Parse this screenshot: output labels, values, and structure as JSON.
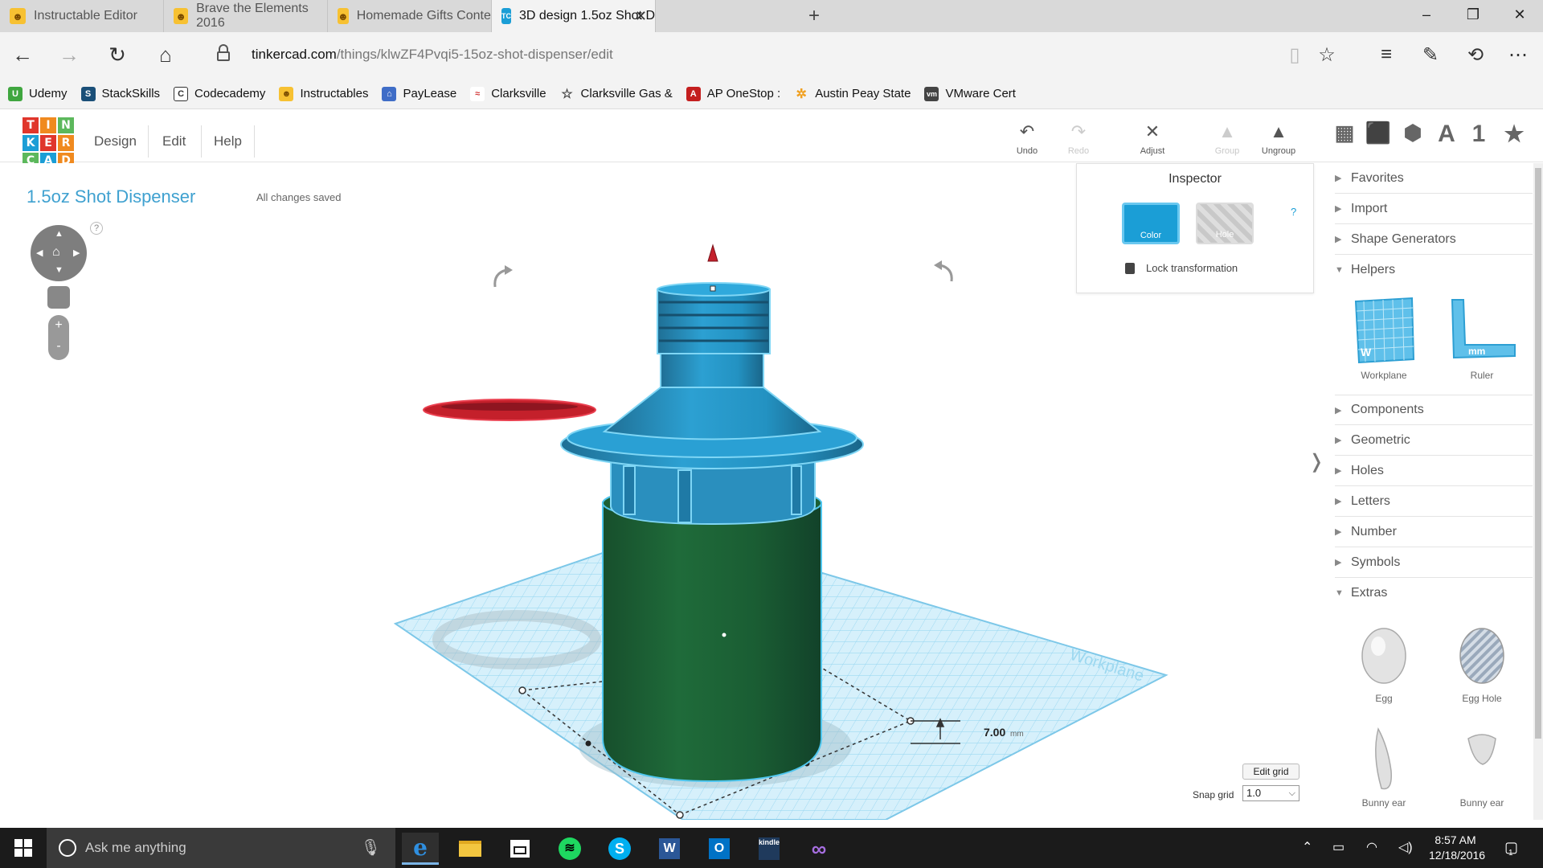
{
  "browser": {
    "tabs": [
      {
        "title": "Instructable Editor",
        "icon": "instructables-robot-icon",
        "color": "#f7c132"
      },
      {
        "title": "Brave the Elements 2016",
        "icon": "instructables-robot-icon",
        "color": "#f7c132"
      },
      {
        "title": "Homemade Gifts Contest 2(",
        "icon": "instructables-robot-icon",
        "color": "#f7c132"
      },
      {
        "title": "3D design 1.5oz Shot D",
        "icon": "tinkercad-icon",
        "color": "#1b9ed6",
        "active": true
      }
    ],
    "url_host": "tinkercad.com",
    "url_path": "/things/klwZF4Pvqi5-15oz-shot-dispenser/edit",
    "favorites": [
      {
        "label": "Udemy",
        "color": "#3fa63f",
        "glyph": "U"
      },
      {
        "label": "StackSkills",
        "color": "#1a4f78",
        "glyph": "S"
      },
      {
        "label": "Codecademy",
        "color": "#333333",
        "glyph": "C"
      },
      {
        "label": "Instructables",
        "color": "#f7c132",
        "glyph": "I"
      },
      {
        "label": "PayLease",
        "color": "#3f6dc7",
        "glyph": "P"
      },
      {
        "label": "Clarksville",
        "color": "#d23a3a",
        "glyph": "C"
      },
      {
        "label": "Clarksville Gas &",
        "color": "#ffffff",
        "glyph": "☆"
      },
      {
        "label": "AP OneStop :",
        "color": "#c41f1f",
        "glyph": "A"
      },
      {
        "label": "Austin Peay State",
        "color": "#f0a020",
        "glyph": "✲"
      },
      {
        "label": "VMware Cert",
        "color": "#444444",
        "glyph": "vm"
      }
    ]
  },
  "app": {
    "logo_letters": [
      "T",
      "I",
      "N",
      "K",
      "E",
      "R",
      "C",
      "A",
      "D"
    ],
    "logo_colors": [
      "#e0362c",
      "#f08a1f",
      "#5cb85c",
      "#1b9ed6",
      "#e0362c",
      "#f08a1f",
      "#5cb85c",
      "#1b9ed6",
      "#f08a1f"
    ],
    "menu": [
      "Design",
      "Edit",
      "Help"
    ],
    "toolbar": {
      "undo": "Undo",
      "redo": "Redo",
      "adjust": "Adjust",
      "group": "Group",
      "ungroup": "Ungroup"
    },
    "view_icons": [
      "grid-view-icon",
      "box-view-icon",
      "wireframe-view-icon",
      "text-icon",
      "number-icon",
      "star-icon"
    ],
    "view_glyphs": [
      "▦",
      "⬛",
      "⬢",
      "A",
      "1",
      "★"
    ],
    "design_title": "1.5oz Shot Dispenser",
    "save_status": "All changes saved",
    "inspector": {
      "title": "Inspector",
      "color_label": "Color",
      "hole_label": "Hole",
      "help": "?",
      "lock_label": "Lock transformation",
      "selected_color": "#1b9ed6"
    },
    "dimension_value": "7.00",
    "dimension_unit": "mm",
    "workplane_watermark": "Workplane",
    "sidebar": {
      "categories_top": [
        {
          "label": "Favorites",
          "expanded": false
        },
        {
          "label": "Import",
          "expanded": false
        },
        {
          "label": "Shape Generators",
          "expanded": false
        },
        {
          "label": "Helpers",
          "expanded": true
        }
      ],
      "helpers": [
        {
          "label": "Workplane",
          "icon": "workplane-icon"
        },
        {
          "label": "Ruler",
          "icon": "ruler-icon"
        }
      ],
      "categories_mid": [
        {
          "label": "Components",
          "expanded": false
        },
        {
          "label": "Geometric",
          "expanded": false
        },
        {
          "label": "Holes",
          "expanded": false
        },
        {
          "label": "Letters",
          "expanded": false
        },
        {
          "label": "Number",
          "expanded": false
        },
        {
          "label": "Symbols",
          "expanded": false
        },
        {
          "label": "Extras",
          "expanded": true
        }
      ],
      "extras": [
        {
          "label": "Egg",
          "icon": "egg-shape-icon"
        },
        {
          "label": "Egg Hole",
          "icon": "egg-hole-shape-icon"
        },
        {
          "label": "Bunny ear",
          "icon": "bunny-ear-shape-icon"
        },
        {
          "label": "Bunny ear",
          "icon": "bunny-ear-2-shape-icon"
        }
      ]
    },
    "edit_grid_label": "Edit grid",
    "snap_grid_label": "Snap grid",
    "snap_grid_value": "1.0"
  },
  "taskbar": {
    "search_placeholder": "Ask me anything",
    "apps": [
      {
        "name": "edge",
        "glyph": "e",
        "color": "#1f7fd6",
        "active": true
      },
      {
        "name": "file-explorer",
        "glyph": "▬",
        "color": "#f3c640"
      },
      {
        "name": "store",
        "glyph": "⊞",
        "color": "#ffffff"
      },
      {
        "name": "spotify",
        "glyph": "●",
        "color": "#1ed760"
      },
      {
        "name": "skype",
        "glyph": "S",
        "color": "#00aff0"
      },
      {
        "name": "word",
        "glyph": "W",
        "color": "#2b5797"
      },
      {
        "name": "outlook",
        "glyph": "O",
        "color": "#0072c6"
      },
      {
        "name": "kindle",
        "glyph": "k",
        "color": "#1f3a5c"
      },
      {
        "name": "visual-studio",
        "glyph": "∞",
        "color": "#8a4fc1"
      }
    ],
    "time": "8:57 AM",
    "date": "12/18/2016",
    "notifications": "1"
  }
}
